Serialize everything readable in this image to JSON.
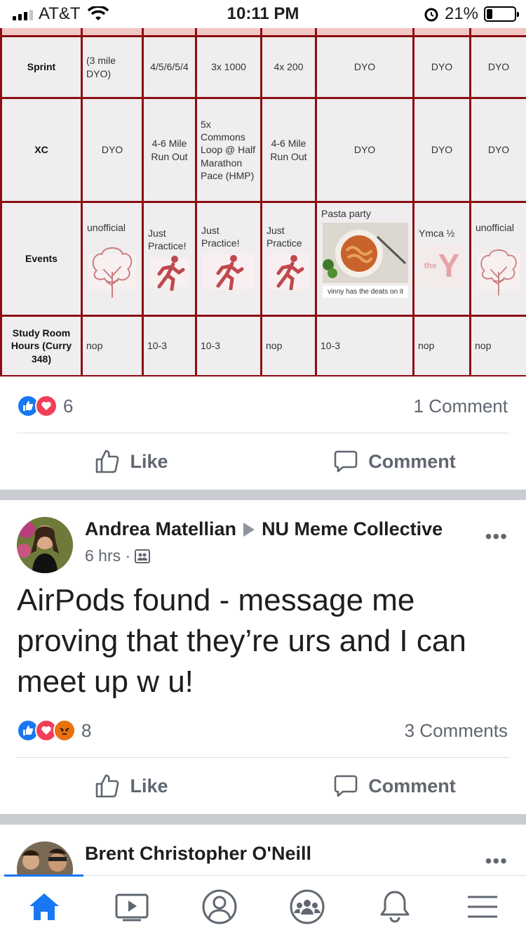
{
  "status_bar": {
    "carrier": "AT&T",
    "time": "10:11 PM",
    "battery": "21%",
    "battery_level": 0.21
  },
  "schedule": {
    "rows": [
      {
        "label": "Sprint",
        "cells": [
          "(3 mile DYO)",
          "4/5/6/5/4",
          "3x 1000",
          "4x 200",
          "DYO",
          "DYO",
          "DYO"
        ]
      },
      {
        "label": "XC",
        "cells": [
          "DYO",
          "4-6 Mile Run Out",
          "5x Commons Loop @ Half Marathon Pace (HMP)",
          "4-6 Mile Run Out",
          "DYO",
          "DYO",
          "DYO"
        ]
      },
      {
        "label": "Events",
        "cells": [
          "unofficial",
          "Just Practice!",
          "Just Practice!",
          "Just Practice",
          "Pasta party",
          "Ymca ½",
          "unofficial"
        ]
      },
      {
        "label": "Study Room Hours (Curry 348)",
        "cells": [
          "nop",
          "10-3",
          "10-3",
          "nop",
          "10-3",
          "nop",
          "nop"
        ]
      }
    ],
    "pasta_note": "vinny has the deats on it",
    "ymca_logo_text": "the"
  },
  "post1": {
    "reaction_count": "6",
    "comment_count": "1 Comment",
    "like_label": "Like",
    "comment_label": "Comment"
  },
  "post2": {
    "author": "Andrea Matellian",
    "group": "NU Meme Collective",
    "time": "6 hrs ·",
    "text": "AirPods found - message me proving that they’re urs and I can meet up w u!",
    "reaction_count": "8",
    "comment_count": "3 Comments",
    "like_label": "Like",
    "comment_label": "Comment"
  },
  "post3": {
    "author": "Brent Christopher O'Neill"
  },
  "nav": {
    "tabs": [
      "home-icon",
      "watch-icon",
      "profile-icon",
      "groups-icon",
      "notifications-icon",
      "menu-icon"
    ],
    "active": "home-icon",
    "accent": "#1877f2"
  }
}
